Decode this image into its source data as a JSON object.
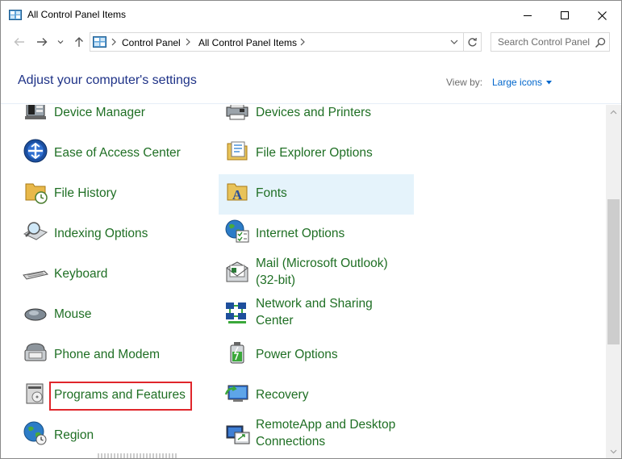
{
  "window": {
    "title": "All Control Panel Items",
    "minimize_icon": "minimize-icon",
    "maximize_icon": "maximize-icon",
    "close_icon": "close-icon"
  },
  "navigation": {
    "back_icon": "back-arrow-icon",
    "forward_icon": "forward-arrow-icon",
    "recent_icon": "chevron-down-icon",
    "up_icon": "up-arrow-icon",
    "breadcrumbs": [
      "Control Panel",
      "All Control Panel Items"
    ],
    "refresh_icon": "refresh-icon"
  },
  "search": {
    "placeholder": "Search Control Panel",
    "icon": "search-icon"
  },
  "header": {
    "title": "Adjust your computer's settings",
    "view_by_label": "View by:",
    "view_by_value": "Large icons"
  },
  "items": {
    "col1": [
      {
        "label": "Device Manager",
        "icon": "device-manager-icon"
      },
      {
        "label": "Ease of Access Center",
        "icon": "ease-of-access-icon"
      },
      {
        "label": "File History",
        "icon": "file-history-icon"
      },
      {
        "label": "Indexing Options",
        "icon": "indexing-options-icon"
      },
      {
        "label": "Keyboard",
        "icon": "keyboard-icon"
      },
      {
        "label": "Mouse",
        "icon": "mouse-icon"
      },
      {
        "label": "Phone and Modem",
        "icon": "phone-modem-icon"
      },
      {
        "label": "Programs and Features",
        "icon": "programs-features-icon"
      },
      {
        "label": "Region",
        "icon": "region-globe-icon"
      }
    ],
    "col2": [
      {
        "label": "Devices and Printers",
        "icon": "printer-icon"
      },
      {
        "label": "File Explorer Options",
        "icon": "folder-options-icon"
      },
      {
        "label": "Fonts",
        "icon": "fonts-folder-icon"
      },
      {
        "label": "Internet Options",
        "icon": "internet-options-icon"
      },
      {
        "label": "Mail (Microsoft Outlook) (32-bit)",
        "icon": "mail-icon"
      },
      {
        "label": "Network and Sharing Center",
        "icon": "network-icon"
      },
      {
        "label": "Power Options",
        "icon": "power-options-icon"
      },
      {
        "label": "Recovery",
        "icon": "recovery-icon"
      },
      {
        "label": "RemoteApp and Desktop Connections",
        "icon": "remoteapp-icon"
      }
    ]
  },
  "colors": {
    "link_green": "#1f6f24",
    "header_blue": "#1e3287",
    "accent_blue": "#0066cc",
    "highlight_bg": "#e5f3fb",
    "annotation_red": "#e0262b"
  }
}
